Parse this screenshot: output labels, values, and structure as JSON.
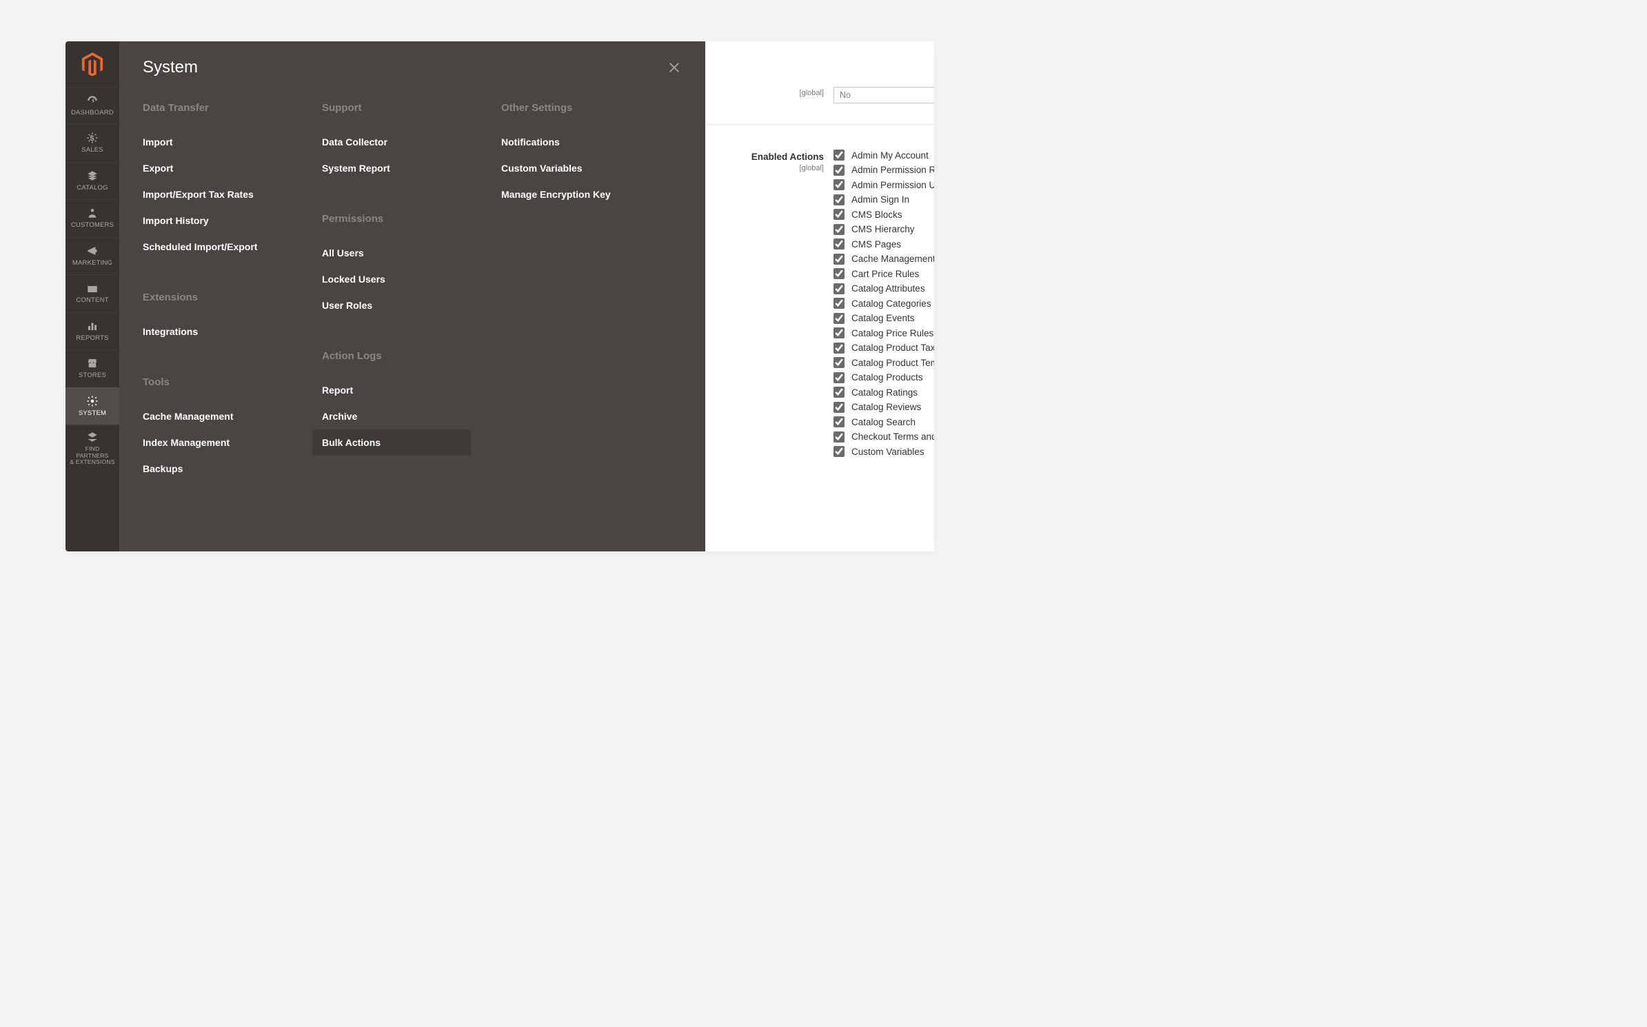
{
  "flyout": {
    "title": "System"
  },
  "admin_nav": [
    {
      "key": "dashboard",
      "label": "DASHBOARD"
    },
    {
      "key": "sales",
      "label": "SALES"
    },
    {
      "key": "catalog",
      "label": "CATALOG"
    },
    {
      "key": "customers",
      "label": "CUSTOMERS"
    },
    {
      "key": "marketing",
      "label": "MARKETING"
    },
    {
      "key": "content",
      "label": "CONTENT"
    },
    {
      "key": "reports",
      "label": "REPORTS"
    },
    {
      "key": "stores",
      "label": "STORES"
    },
    {
      "key": "system",
      "label": "SYSTEM",
      "active": true
    },
    {
      "key": "partners",
      "label": "FIND PARTNERS\n& EXTENSIONS"
    }
  ],
  "system_menu": {
    "col1": [
      {
        "heading": "Data Transfer",
        "items": [
          "Import",
          "Export",
          "Import/Export Tax Rates",
          "Import History",
          "Scheduled Import/Export"
        ]
      },
      {
        "heading": "Extensions",
        "items": [
          "Integrations"
        ]
      },
      {
        "heading": "Tools",
        "items": [
          "Cache Management",
          "Index Management",
          "Backups"
        ]
      }
    ],
    "col2": [
      {
        "heading": "Support",
        "items": [
          "Data Collector",
          "System Report"
        ]
      },
      {
        "heading": "Permissions",
        "items": [
          "All Users",
          "Locked Users",
          "User Roles"
        ]
      },
      {
        "heading": "Action Logs",
        "items": [
          "Report",
          "Archive",
          "Bulk Actions"
        ]
      }
    ],
    "col3": [
      {
        "heading": "Other Settings",
        "items": [
          "Notifications",
          "Custom Variables",
          "Manage Encryption Key"
        ]
      }
    ],
    "highlight": "Bulk Actions"
  },
  "content": {
    "top_field": {
      "scope": "[global]",
      "value": "No"
    },
    "enabled_actions_label": "Enabled Actions",
    "enabled_actions_scope": "[global]",
    "enabled_actions": [
      "Admin My Account",
      "Admin Permission Roles",
      "Admin Permission Users",
      "Admin Sign In",
      "CMS Blocks",
      "CMS Hierarchy",
      "CMS Pages",
      "Cache Management",
      "Cart Price Rules",
      "Catalog Attributes",
      "Catalog Categories",
      "Catalog Events",
      "Catalog Price Rules",
      "Catalog Product Tax Classe",
      "Catalog Product Templates",
      "Catalog Products",
      "Catalog Ratings",
      "Catalog Reviews",
      "Catalog Search",
      "Checkout Terms and Condi",
      "Custom Variables"
    ]
  }
}
